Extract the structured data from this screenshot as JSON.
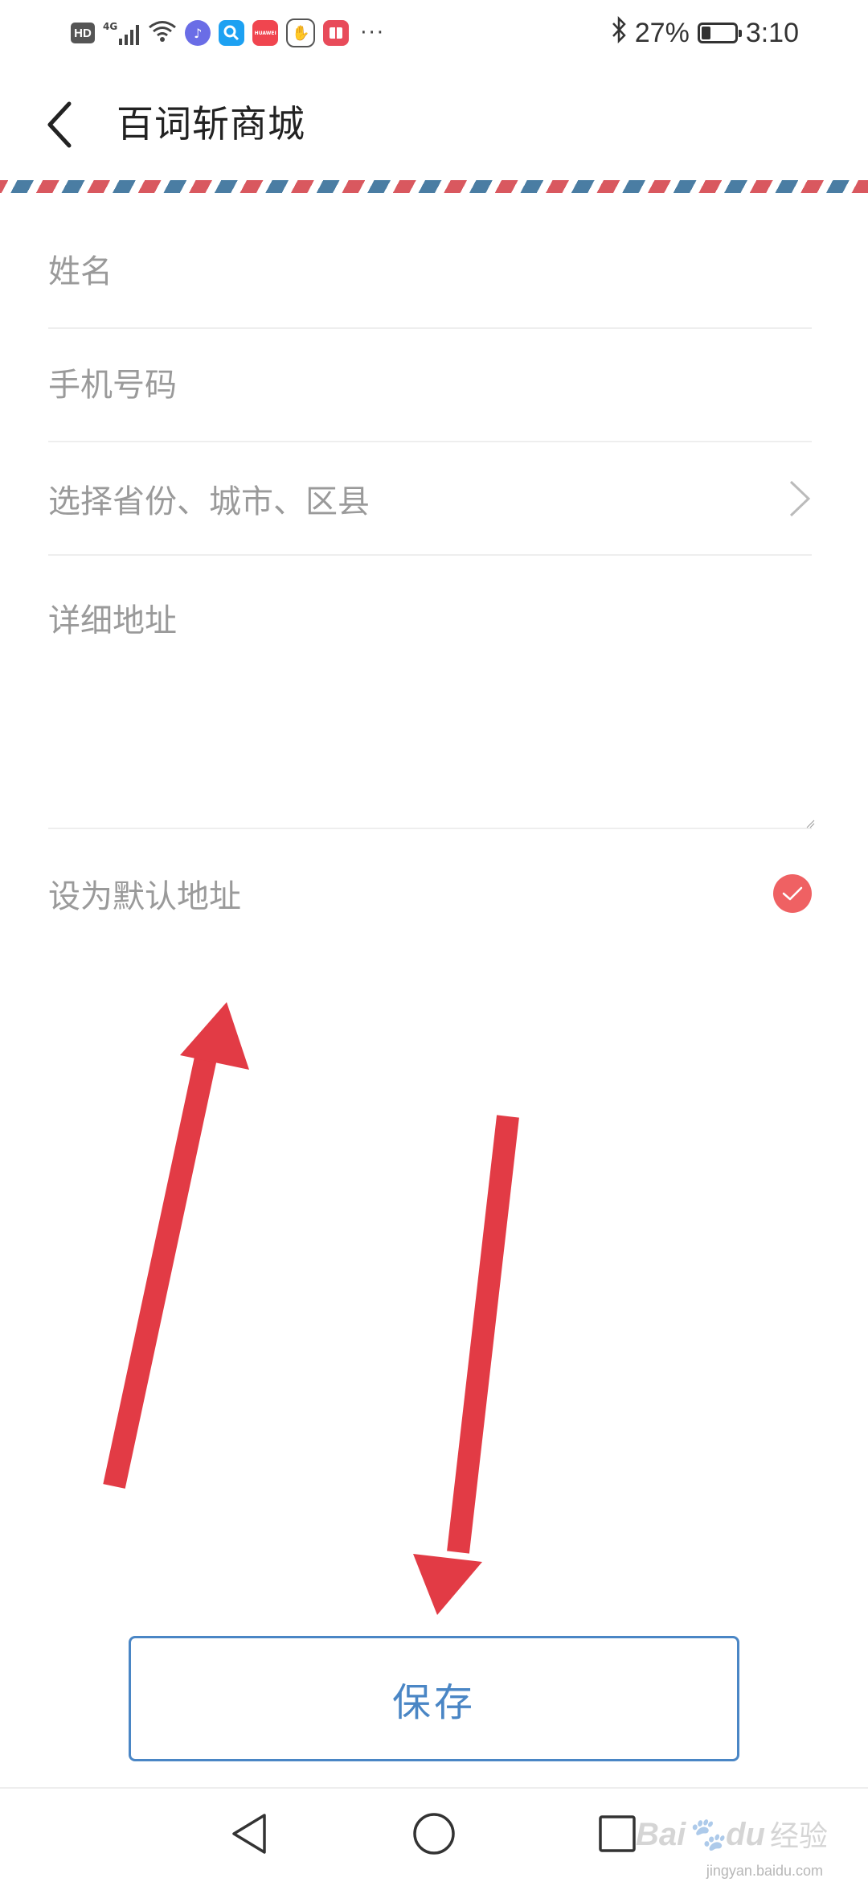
{
  "status_bar": {
    "network": "HD",
    "signal": "4G",
    "battery_percent": "27%",
    "battery_level": 0.27,
    "time": "3:10",
    "notification_icons": [
      "music-icon",
      "search-app-icon",
      "huawei-app-icon",
      "hand-app-icon",
      "book-app-icon"
    ],
    "overflow": "···",
    "huawei_label": "HUAWEI"
  },
  "header": {
    "title": "百词斩商城"
  },
  "form": {
    "name_placeholder": "姓名",
    "phone_placeholder": "手机号码",
    "region_placeholder": "选择省份、城市、区县",
    "address_placeholder": "详细地址",
    "default_label": "设为默认地址",
    "default_checked": true
  },
  "save_button": {
    "label": "保存"
  },
  "watermark": {
    "brand": "Bai",
    "brand2": "du",
    "cn": "经验",
    "url": "jingyan.baidu.com"
  },
  "colors": {
    "accent_blue": "#4a86c5",
    "check_red": "#ef6163",
    "arrow_red": "#e23b45",
    "stripe_red": "#d9585f",
    "stripe_blue": "#4a7da3"
  }
}
